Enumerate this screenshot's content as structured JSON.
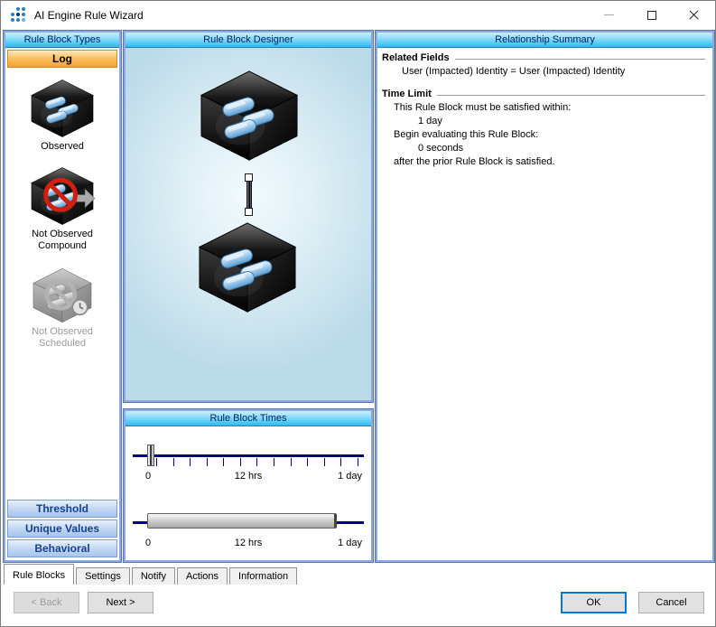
{
  "window": {
    "title": "AI Engine Rule Wizard"
  },
  "colors": {
    "header_gradient_top": "#cdeffd",
    "header_gradient_bottom": "#29bcf3",
    "header_text": "#002366",
    "panel_border": "#8ea9de",
    "log_button_gradient_top": "#fde8bd",
    "log_button_gradient_bottom": "#f6a132",
    "type_button_text": "#16418f",
    "slider_track": "#000080",
    "prohibition_red": "#d11f10",
    "ok_focus_border": "#0078d7"
  },
  "left_panel": {
    "header": "Rule Block Types",
    "log_button": "Log",
    "items": [
      {
        "label": "Observed"
      },
      {
        "label": "Not Observed Compound"
      },
      {
        "label": "Not Observed Scheduled"
      }
    ],
    "bottom_buttons": [
      "Threshold",
      "Unique Values",
      "Behavioral"
    ]
  },
  "designer_panel": {
    "header": "Rule Block Designer"
  },
  "times_panel": {
    "header": "Rule Block Times",
    "slider1_labels": [
      "0",
      "12 hrs",
      "1 day"
    ],
    "slider2_labels": [
      "0",
      "12 hrs",
      "1 day"
    ]
  },
  "summary_panel": {
    "header": "Relationship Summary",
    "related_fields_title": "Related Fields",
    "related_fields_line": "User (Impacted) Identity = User (Impacted) Identity",
    "time_limit_title": "Time Limit",
    "time_limit_lines": [
      "This Rule Block must be satisfied within:",
      "1 day",
      "Begin evaluating this Rule Block:",
      "0 seconds",
      "after the prior Rule Block is satisfied."
    ]
  },
  "tabs": [
    "Rule Blocks",
    "Settings",
    "Notify",
    "Actions",
    "Information"
  ],
  "footer": {
    "back": "< Back",
    "next": "Next >",
    "ok": "OK",
    "cancel": "Cancel"
  }
}
